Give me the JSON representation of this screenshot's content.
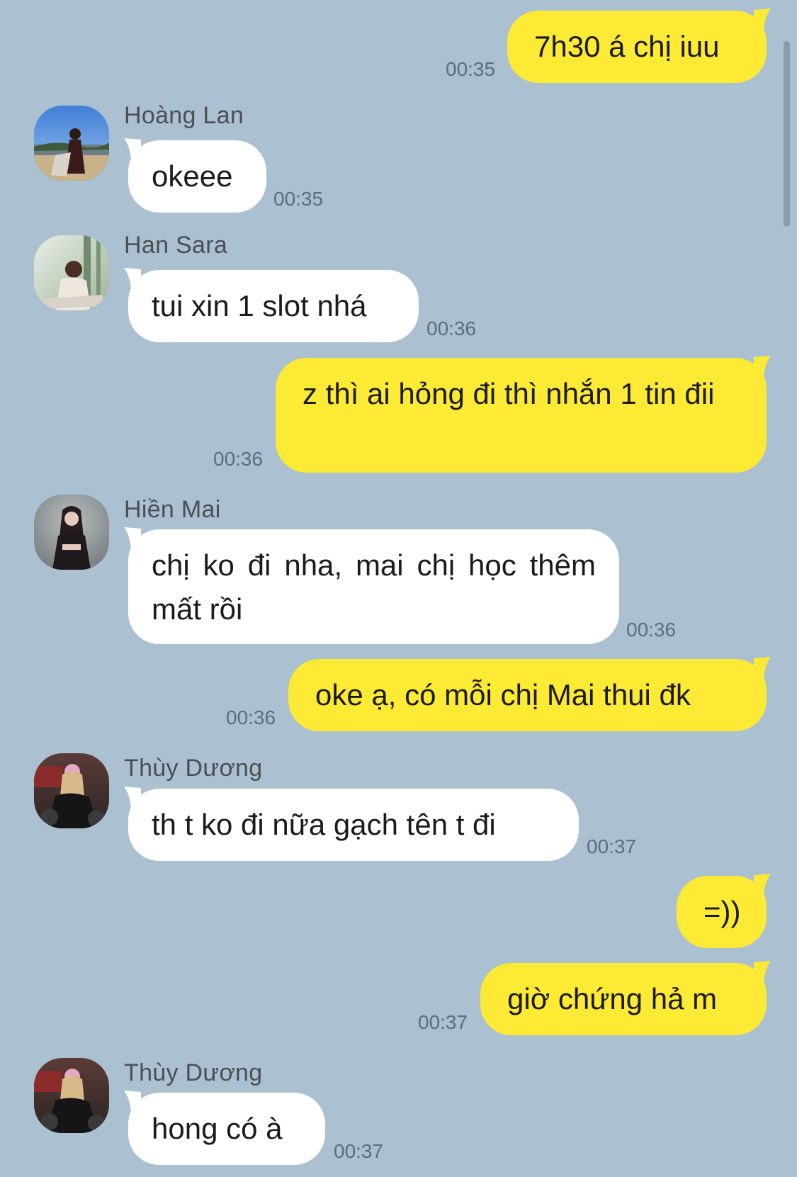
{
  "colors": {
    "background": "#abc1d1",
    "incoming_bubble": "#ffffff",
    "outgoing_bubble": "#fdea34",
    "sender_name": "#4b4f55",
    "timestamp": "#5b6e7d"
  },
  "messages": [
    {
      "direction": "outgoing",
      "text": "7h30 á chị iuu",
      "time": "00:35"
    },
    {
      "direction": "incoming",
      "sender": "Hoàng Lan",
      "avatar": "profile-photo",
      "text": "okeee",
      "time": "00:35"
    },
    {
      "direction": "incoming",
      "sender": "Han Sara",
      "avatar": "profile-photo",
      "text": "tui xin 1 slot nhá",
      "time": "00:36"
    },
    {
      "direction": "outgoing",
      "text": "z thì ai hỏng đi thì nhắn 1 tin đii",
      "time": "00:36"
    },
    {
      "direction": "incoming",
      "sender": "Hiền Mai",
      "avatar": "profile-photo",
      "text": "chị ko đi nha, mai chị học thêm mất rồi",
      "time": "00:36"
    },
    {
      "direction": "outgoing",
      "text": "oke ạ, có mỗi chị Mai thui đk",
      "time": "00:36"
    },
    {
      "direction": "incoming",
      "sender": "Thùy Dương",
      "avatar": "profile-photo",
      "text": "th t ko đi nữa gạch tên t đi",
      "time": "00:37"
    },
    {
      "direction": "outgoing",
      "text": "=))",
      "time": ""
    },
    {
      "direction": "outgoing",
      "text": "giờ chứng hả m",
      "time": "00:37"
    },
    {
      "direction": "incoming",
      "sender": "Thùy Dương",
      "avatar": "profile-photo",
      "text": "hong có à",
      "time": "00:37"
    }
  ]
}
